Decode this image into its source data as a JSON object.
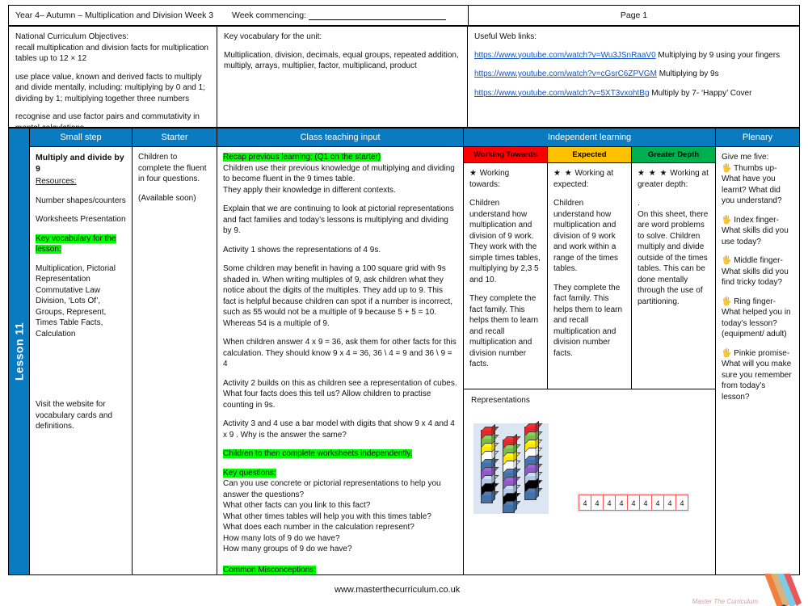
{
  "header": {
    "title": "Year 4– Autumn – Multiplication and Division Week 3",
    "week_commencing_label": "Week commencing:",
    "page_label": "Page 1"
  },
  "info": {
    "nc": {
      "heading": "National Curriculum Objectives:",
      "line1": "recall multiplication and division facts for multiplication tables up to 12 × 12",
      "line2": "use place value, known and derived facts to multiply and divide mentally, including: multiplying by 0 and 1; dividing by 1; multiplying together three numbers",
      "line3": "recognise and use factor pairs and commutativity in mental calculations"
    },
    "vocab": {
      "heading": "Key vocabulary for the unit:",
      "text": "Multiplication, division, decimals, equal groups, repeated addition, multiply, arrays, multiplier, factor, multiplicand, product"
    },
    "links": {
      "heading": "Useful Web links:",
      "items": [
        {
          "url": "https://www.youtube.com/watch?v=Wu3JSnRaaV0",
          "caption": " Multiplying by 9 using your fingers"
        },
        {
          "url": "https://www.youtube.com/watch?v=cGsrC6ZPVGM",
          "caption": " Multiplying by 9s"
        },
        {
          "url": "https://www.youtube.com/watch?v=5XT3vxohtBg",
          "caption": " Multiply by 7- ‘Happy’ Cover"
        }
      ]
    }
  },
  "columns": {
    "lesson": "Lesson 11",
    "small_step": "Small step",
    "starter": "Starter",
    "class_teaching": "Class teaching input",
    "independent": "Independent learning",
    "plenary": "Plenary"
  },
  "small_step": {
    "title": "Multiply and divide by 9",
    "resources_label": "Resources:",
    "resource1": "Number shapes/counters",
    "resource2": "Worksheets Presentation",
    "vocab_heading": "Key vocabulary for the lesson:",
    "vocab_list": "Multiplication, Pictorial Representation Commutative Law Division, ‘Lots Of’, Groups, Represent, Times Table Facts, Calculation",
    "footer_note": "Visit the website for vocabulary cards and definitions."
  },
  "starter": {
    "text": "Children to complete the fluent in four questions.",
    "note": "(Available soon)"
  },
  "teaching": {
    "recap_heading": "Recap previous learning: (Q1 on the starter)",
    "p1": "Children use their previous knowledge of multiplying and dividing to become fluent in the 9 times table.",
    "p2": "They apply their knowledge in different contexts.",
    "p3": "Explain that we are continuing to look at pictorial representations and fact families and today’s lessons is multiplying and dividing by 9.",
    "p4": "Activity 1 shows the representations of 4 9s.",
    "p5": "Some children may benefit in having a 100 square  grid with 9s shaded in. When writing multiples of 9, ask children what they notice about the digits of the multiples. They add up to 9. This fact is helpful because children can spot if a number is incorrect, such as 55 would not be a multiple of 9 because 5 + 5 = 10. Whereas 54 is a multiple of 9.",
    "p6": "When children answer 4 x 9 = 36, ask them for other facts for this calculation. They should know 9 x 4 = 36, 36 \\ 4 = 9 and 36 \\ 9 = 4",
    "p7": "Activity 2 builds on this as children see a representation of cubes. What four facts does this tell us? Allow children to practise counting in 9s.",
    "p8": "Activity 3 and 4 use a bar model with digits that show 9 x 4 and 4 x 9 . Why is the answer the same?",
    "worksheets_note": "Children to then complete worksheets independently.",
    "key_questions_heading": "Key questions:",
    "q1": "Can you use concrete or pictorial representations to help you answer the questions?",
    "q2": "What other facts can you link to this fact?",
    "q3": "What other times tables will help you with this times table?",
    "q4": "What does each number in the calculation represent?",
    "q5": "How many lots of 9 do we have?",
    "q6": "How many groups of 9 do we have?",
    "misconceptions_heading": "Common Misconceptions:"
  },
  "independent": {
    "bands": [
      {
        "label": "Working Towards",
        "color": "#ff0000"
      },
      {
        "label": "Expected",
        "color": "#ffc000"
      },
      {
        "label": "Greater Depth",
        "color": "#00b050"
      }
    ],
    "working_towards": {
      "stars": "★",
      "heading": "Working towards:",
      "p1": "Children understand how multiplication and division of 9 work. They work with the simple times tables, multiplying by 2,3 5 and 10.",
      "p2": "They complete the fact family. This helps them to learn and recall multiplication and division number facts."
    },
    "expected": {
      "stars": "★ ★",
      "heading": "Working at expected:",
      "p1": "Children understand how multiplication and division of 9 work and work within a range of the times tables.",
      "p2": "They complete the fact family. This helps them to learn and recall multiplication and division number facts."
    },
    "greater_depth": {
      "stars": "★ ★ ★",
      "heading": "Working at greater depth:",
      "p1": ".",
      "p2": "On this sheet, there are word problems to solve. Children multiply and divide outside of the times tables. This can be done mentally through the use of partitioning."
    },
    "representations_title": "Representations",
    "bar_model_values": [
      "4",
      "4",
      "4",
      "4",
      "4",
      "4",
      "4",
      "4",
      "4"
    ],
    "cube_colors": [
      "#e8262a",
      "#7cbb4a",
      "#ffe600",
      "#ffffff",
      "#4472a8",
      "#8e5ac8",
      "#b4c7e7",
      "#000000",
      "#4472a8"
    ]
  },
  "plenary": {
    "heading": "Give me five:",
    "items": [
      {
        "icon": "hand-icon",
        "text": " Thumbs up- What have you learnt? What did you understand?"
      },
      {
        "icon": "hand-icon",
        "text": " Index finger- What skills did you use today?"
      },
      {
        "icon": "hand-icon",
        "text": " Middle finger- What skills did you find tricky today?"
      },
      {
        "icon": "hand-icon",
        "text": " Ring finger- What helped you in today’s lesson? (equipment/ adult)"
      },
      {
        "icon": "hand-icon",
        "text": " Pinkie promise- What will you make sure you remember from today’s lesson?"
      }
    ]
  },
  "footer": {
    "url": "www.masterthecurriculum.co.uk",
    "logo_text": "Master The Curriculum"
  }
}
